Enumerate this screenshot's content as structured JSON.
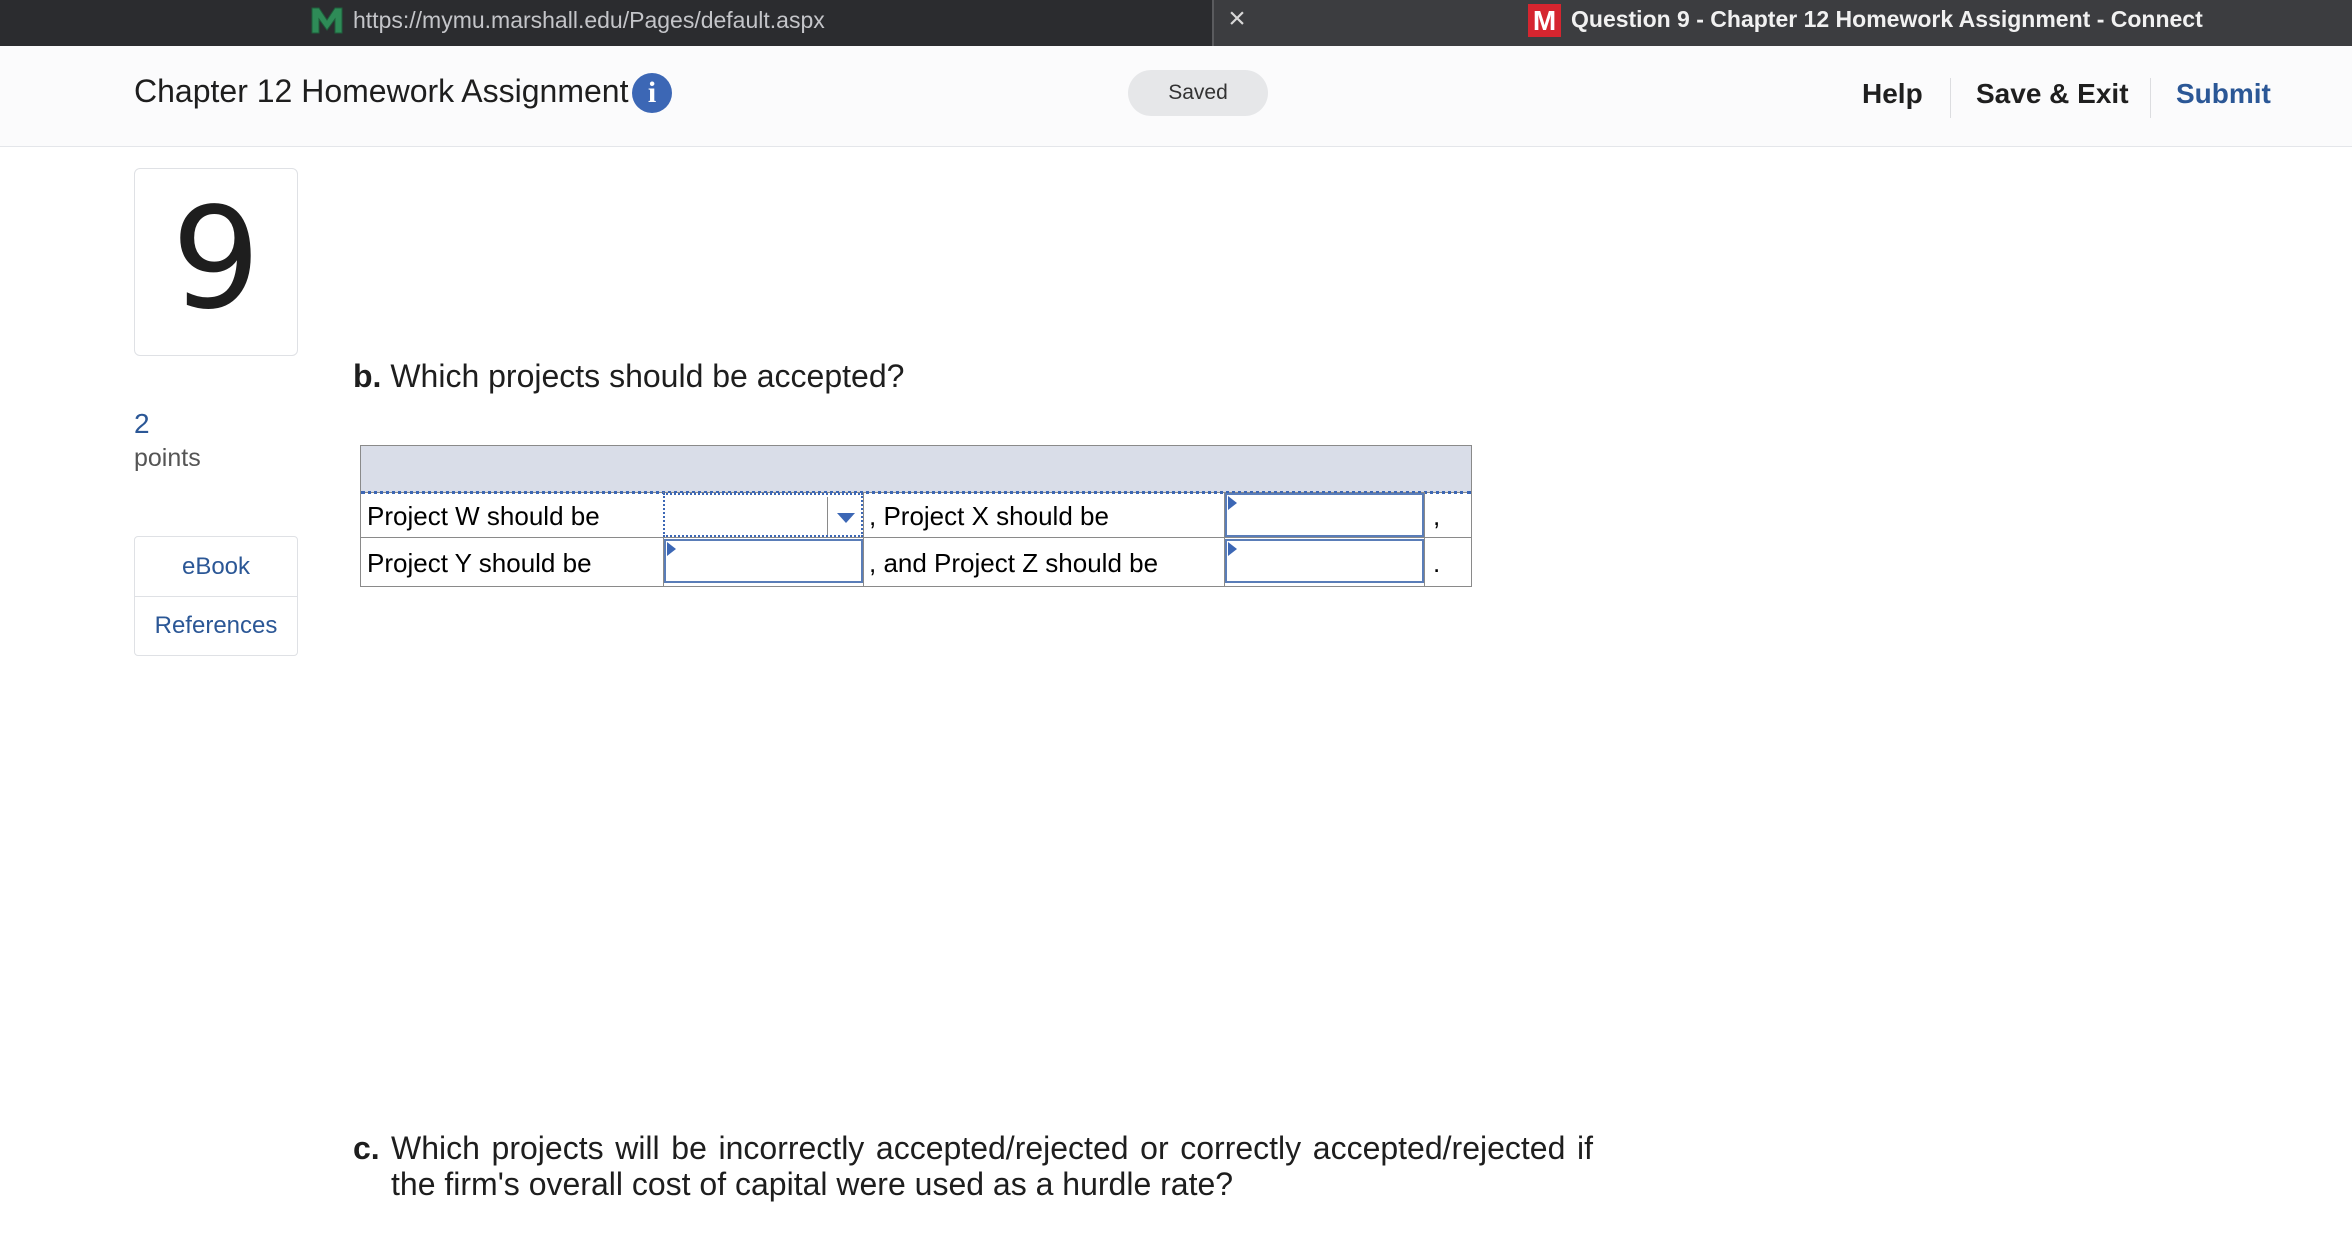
{
  "browser": {
    "left_tab_url": "https://mymu.marshall.edu/Pages/default.aspx",
    "close_glyph": "×",
    "right_tab_logo": "M",
    "right_tab_title": "Question 9 - Chapter 12 Homework Assignment - Connect"
  },
  "header": {
    "title": "Chapter 12 Homework Assignment",
    "info_glyph": "i",
    "status": "Saved",
    "help_label": "Help",
    "save_exit_label": "Save & Exit",
    "submit_label": "Submit"
  },
  "sidebar": {
    "question_number": "9",
    "points_value": "2",
    "points_label": "points",
    "links": [
      "eBook",
      "References"
    ]
  },
  "question_b": {
    "letter": "b.",
    "text": "Which projects should be accepted?",
    "rows": [
      {
        "label": "Project W should be",
        "mid_label": ", Project X should be",
        "end": ","
      },
      {
        "label": "Project Y should be",
        "mid_label": ", and Project Z should be",
        "end": "."
      }
    ],
    "dropdown_value": "",
    "inputs": [
      "",
      "",
      ""
    ]
  },
  "question_c": {
    "letter": "c.",
    "text": "Which projects will be incorrectly accepted/rejected or correctly accepted/rejected if the firm's overall cost of capital were used as a hurdle rate?"
  },
  "colors": {
    "accent_blue": "#2b5796",
    "info_blue": "#3c67b5",
    "brand_red": "#d5252f",
    "brand_green": "#2e8b57"
  }
}
